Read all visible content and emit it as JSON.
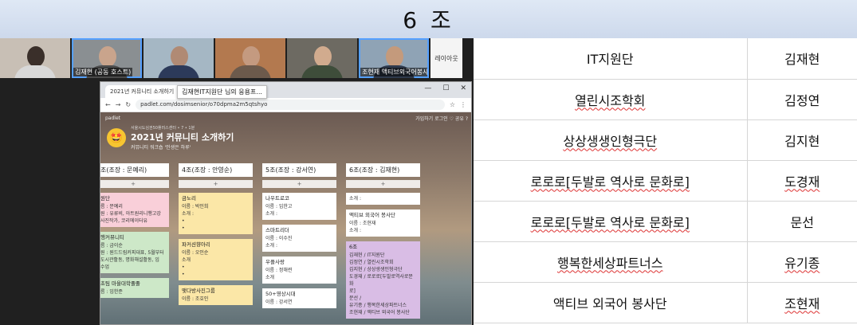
{
  "slide_title": "6 조",
  "video": {
    "tiles": [
      {
        "caption": "",
        "head": "#3a2f2a",
        "body": "#d8d8d8",
        "bg": "#c8bfb5"
      },
      {
        "caption": "김재현 (공동 호스트)",
        "head": "#c9a48c",
        "body": "#4b4b4b",
        "bg": "#8a8f92"
      },
      {
        "caption": "",
        "head": "#b08a74",
        "body": "#2c3a5a",
        "bg": "#a5b7c4"
      },
      {
        "caption": "",
        "head": "#c49a80",
        "body": "#6c5a4c",
        "bg": "#b3794f"
      },
      {
        "caption": "",
        "head": "#d1ab8e",
        "body": "#3e4d3a",
        "bg": "#6d6a62"
      },
      {
        "caption": "조현재 액티브외국어봉사...",
        "head": "#c49a7c",
        "body": "#2f3a4d",
        "bg": "#8fa3b5"
      }
    ],
    "layout_label": "레이아웃"
  },
  "browser": {
    "tab_title": "2021년 커뮤니티 소개하기",
    "tooltip": "김재현IT지원단 님의 응용프...",
    "url": "padlet.com/dosimsenior/o70dpma2m5qtshyo",
    "window_controls": [
      "—",
      "☐",
      "✕"
    ]
  },
  "padlet": {
    "brand": "padlet",
    "top_right": "가입하기   로그인   ♡   공유   ?",
    "org": "서울시도심권50플러스센터 • 7 • 1분",
    "emoji": "🤩",
    "title": "2021년 커뮤니티 소개하기",
    "subtitle": "커뮤니티 워크숍 '인생은 하루'",
    "columns": [
      {
        "header": "조(조장 : 문예리)",
        "cards": [
          {
            "color": "pink",
            "title": "원단",
            "lines": [
              "름 : 문예리",
              "원 : 유류비, 아트원리니행고강",
              "사진작가, 코리에이터유"
            ]
          },
          {
            "color": "green",
            "title": "행커뮤니티",
            "lines": [
              "름 : 금이순",
              "원 : 원드드림커피대표, 5월부터",
              "도시관활동, 명화해설활동, 임",
              "수업"
            ]
          },
          {
            "color": "green",
            "title": "초팀 마을대학졸졸",
            "lines": [
              "름 : 임한준"
            ]
          }
        ]
      },
      {
        "header": "4조(조장 : 안영순)",
        "cards": [
          {
            "color": "yellow",
            "title": "금노리",
            "lines": [
              "이름 : 박인희",
              "소개 :",
              "•",
              "•"
            ]
          },
          {
            "color": "yellow",
            "title": "파커션향아리",
            "lines": [
              "이름 : 오인순",
              "소개",
              "•",
              "•"
            ]
          },
          {
            "color": "yellow",
            "title": "맺다방사진그룹",
            "lines": [
              "이름 : 조호인"
            ]
          }
        ]
      },
      {
        "header": "5조(조장 : 강서연)",
        "cards": [
          {
            "color": "white",
            "title": "나우트로코",
            "lines": [
              "이름 : 임한고",
              "소개 :"
            ]
          },
          {
            "color": "white",
            "title": "스마트리더",
            "lines": [
              "이름 : 이수진",
              "소개 :"
            ]
          },
          {
            "color": "white",
            "title": "우플사랑",
            "lines": [
              "이름 : 정해련",
              "소개"
            ]
          },
          {
            "color": "white",
            "title": "50+영상시대",
            "lines": [
              "이름 : 강서연"
            ]
          }
        ]
      },
      {
        "header": "6조(조장 : 김재현)",
        "cards": [
          {
            "color": "white",
            "title": "",
            "lines": [
              "소개 :"
            ]
          },
          {
            "color": "white",
            "title": "액티브 외국어 봉사단",
            "lines": [
              "이름 : 조현재",
              "소개 :"
            ]
          },
          {
            "color": "purple",
            "title": "6조",
            "lines": [
              "김재현 / IT지원단",
              "김정연 / 열린시조학회",
              "김지현 / 상상생생인형극단",
              "도경재 / 로로로[두발로역사로문화",
              "로]",
              "문선 /",
              "유기종 / 행복한세상파트너스",
              "조현재 / 액티브 외국어 봉사단"
            ]
          }
        ]
      }
    ]
  },
  "table": [
    {
      "org": "IT지원단",
      "name": "김재현",
      "org_squiggle": false,
      "name_squiggle": false
    },
    {
      "org": "열린시조학회",
      "name": "김정연",
      "org_squiggle": true,
      "name_squiggle": false
    },
    {
      "org": "상상생생인형극단",
      "name": "김지현",
      "org_squiggle": true,
      "name_squiggle": false
    },
    {
      "org": "로로로[두발로 역사로 문화로]",
      "name": "도경재",
      "org_squiggle": true,
      "name_squiggle": true
    },
    {
      "org": "로로로[두발로 역사로 문화로]",
      "name": "문선",
      "org_squiggle": true,
      "name_squiggle": false
    },
    {
      "org": "행복한세상파트너스",
      "name": "유기종",
      "org_squiggle": true,
      "name_squiggle": true
    },
    {
      "org": "액티브 외국어 봉사단",
      "name": "조현재",
      "org_squiggle": false,
      "name_squiggle": true
    }
  ]
}
